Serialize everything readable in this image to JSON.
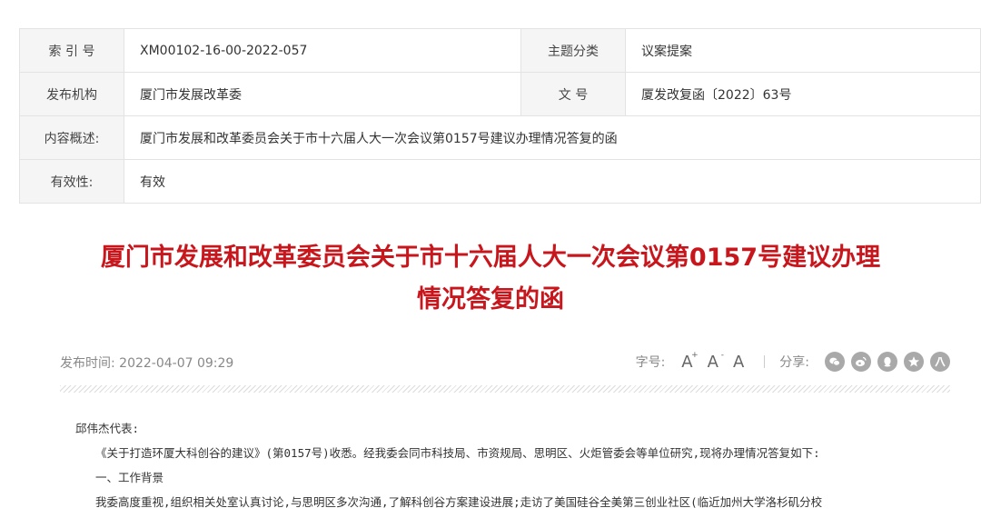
{
  "meta": {
    "index_label": "索 引 号",
    "index_value": "XM00102-16-00-2022-057",
    "category_label": "主题分类",
    "category_value": "议案提案",
    "issuer_label": "发布机构",
    "issuer_value": "厦门市发展改革委",
    "docno_label": "文 号",
    "docno_value": "厦发改复函〔2022〕63号",
    "summary_label": "内容概述:",
    "summary_value": "厦门市发展和改革委员会关于市十六届人大一次会议第0157号建议办理情况答复的函",
    "validity_label": "有效性:",
    "validity_value": "有效"
  },
  "article": {
    "title_line1": "厦门市发展和改革委员会关于市十六届人大一次会议第0157号建议办理",
    "title_line2": "情况答复的函",
    "publish_time": "发布时间: 2022-04-07 09:29"
  },
  "tools": {
    "fontsize_label": "字号:",
    "font_large": "A",
    "font_large_sup": "+",
    "font_small": "A",
    "font_small_sup": "-",
    "font_normal": "A",
    "share_label": "分享:",
    "share_icons": [
      "wechat-icon",
      "weibo-icon",
      "qq-icon",
      "qzone-icon",
      "renren-icon"
    ]
  },
  "content": {
    "p1": "邱伟杰代表:",
    "p2": "《关于打造环厦大科创谷的建议》(第0157号)收悉。经我委会同市科技局、市资规局、思明区、火炬管委会等单位研究,现将办理情况答复如下:",
    "p3": "一、工作背景",
    "p4": "我委高度重视,组织相关处室认真讨论,与思明区多次沟通,了解科创谷方案建设进展;走访了美国硅谷全美第三创业社区(临近加州大学洛杉矶分校"
  },
  "colors": {
    "title_red": "#c8161d",
    "label_bg": "#f5f5f5",
    "border": "#e3e3e3",
    "icon_gray": "#a9a9a9"
  }
}
